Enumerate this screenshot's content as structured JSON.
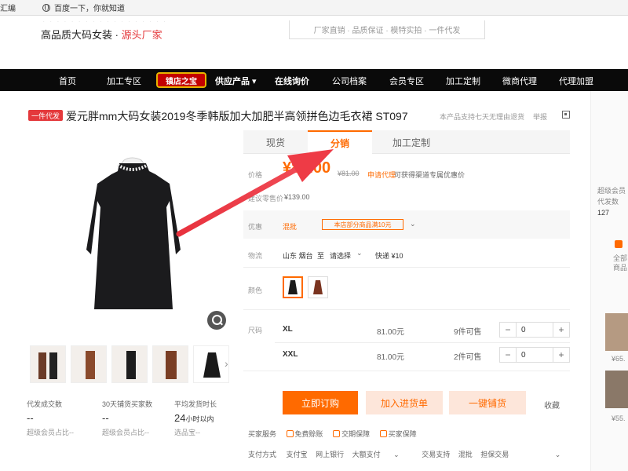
{
  "bookmarks": {
    "item1": "汇编",
    "item2": "百度一下，你就知道"
  },
  "header": {
    "slogan_prefix": "高品质大码女装 · ",
    "slogan_accent": "源头厂家",
    "promise": "厂家直销 · 品质保证 · 模特实拍 · 一件代发"
  },
  "nav": {
    "items": [
      "首页",
      "加工专区",
      "供应产品 ▾",
      "在线询价",
      "公司档案",
      "会员专区",
      "加工定制",
      "微商代理",
      "代理加盟"
    ],
    "badge": "镇店之宝"
  },
  "product": {
    "tag": "一件代发",
    "title": "爱元胖mm大码女装2019冬季韩版加大加肥半高领拼色边毛衣裙 ST097",
    "return_policy": "本产品支持七天无理由退货",
    "report": "举报"
  },
  "tabs": [
    {
      "label": "现货"
    },
    {
      "label": "分销"
    },
    {
      "label": "加工定制"
    }
  ],
  "pricing": {
    "price_label": "价格",
    "price": "¥81.00",
    "original_price": "¥81.00",
    "apply_link": "申请代理",
    "apply_text": "可获得渠道专属优惠价",
    "retail_label": "建议零售价",
    "retail_price": "¥139.00"
  },
  "promo": {
    "label": "优惠",
    "type": "混批",
    "detail": "本店部分商品满10元"
  },
  "shipping": {
    "label": "物流",
    "from": "山东 烟台",
    "to_word": "至",
    "select": "请选择",
    "express": "快递 ¥10"
  },
  "color": {
    "label": "颜色"
  },
  "sizes": {
    "label": "尺码",
    "rows": [
      {
        "name": "XL",
        "price": "81.00元",
        "stock": "9件可售",
        "qty": "0"
      },
      {
        "name": "XXL",
        "price": "81.00元",
        "stock": "2件可售",
        "qty": "0"
      }
    ]
  },
  "actions": {
    "buy": "立即订购",
    "cart": "加入进货单",
    "one_click": "一键铺货",
    "favorite": "收藏"
  },
  "services": {
    "label": "买家服务",
    "items": [
      "免费赊账",
      "交期保障",
      "买家保障"
    ],
    "pay_label": "支付方式",
    "pay_items": [
      "支付宝",
      "网上银行",
      "大额支付"
    ],
    "trade_label": "交易支持",
    "trade_items": [
      "混批",
      "担保交易"
    ]
  },
  "stats": [
    {
      "label": "代发成交数",
      "value": "--",
      "sub": "超级会员占比--"
    },
    {
      "label": "30天铺货买家数",
      "value": "--",
      "sub": "超级会员占比--"
    },
    {
      "label": "平均发货时长",
      "value": "24",
      "value_unit": "小时以内",
      "sub": "选品宝--"
    }
  ],
  "side": {
    "line1": "超级会员",
    "line2": "代发数",
    "line3": "127",
    "line4": "全部",
    "line5": "商品",
    "price1": "¥65.",
    "price2": "¥55."
  },
  "colors": {
    "accent": "#ff6a00",
    "red": "#e4393c",
    "nav_bg": "#0a0a0a"
  }
}
